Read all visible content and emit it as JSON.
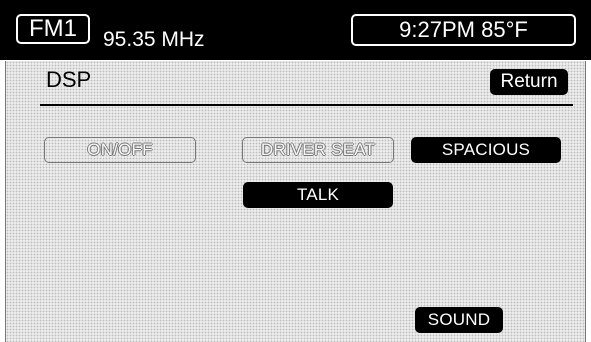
{
  "header": {
    "band": "FM1",
    "frequency": "95.35 MHz",
    "clock": "9:27PM 85°F"
  },
  "page": {
    "title": "DSP",
    "return_label": "Return"
  },
  "buttons": {
    "on_off": "ON/OFF",
    "driver_seat": "DRIVER SEAT",
    "spacious": "SPACIOUS",
    "talk": "TALK",
    "sound": "SOUND"
  },
  "colors": {
    "header_bg": "#000000",
    "content_bg": "#ececec",
    "active_button": "#000000"
  }
}
